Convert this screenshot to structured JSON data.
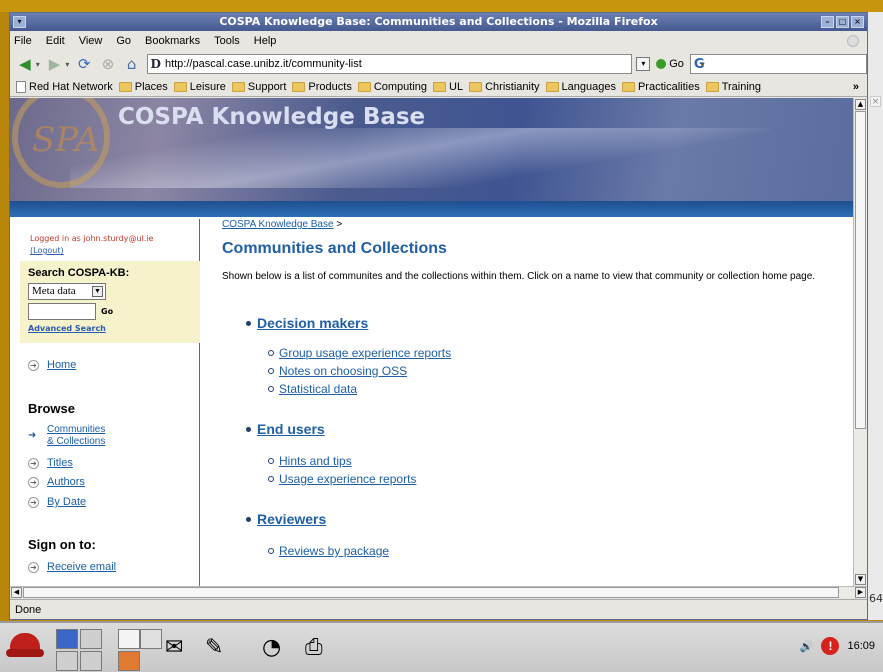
{
  "window": {
    "title": "COSPA Knowledge Base: Communities and Collections - Mozilla Firefox"
  },
  "menu": [
    "File",
    "Edit",
    "View",
    "Go",
    "Bookmarks",
    "Tools",
    "Help"
  ],
  "nav": {
    "url": "http://pascal.case.unibz.it/community-list",
    "go_label": "Go",
    "search_engine_icon": "G"
  },
  "bookmarks": [
    "Red Hat Network",
    "Places",
    "Leisure",
    "Support",
    "Products",
    "Computing",
    "UL",
    "Christianity",
    "Languages",
    "Practicalities",
    "Training"
  ],
  "bookmarks_more": "»",
  "banner": {
    "logo_letters": "SPA",
    "brand": "COSPA Knowledge Base"
  },
  "sidebar": {
    "logged_in": "Logged in as john.sturdy@ul.ie",
    "logout": "(Logout)",
    "search_heading": "Search COSPA-KB:",
    "search_scope": "Meta data",
    "go": "Go",
    "advanced": "Advanced Search",
    "home": "Home",
    "browse_heading": "Browse",
    "browse_communities_line1": "Communities",
    "browse_communities_line2": "& Collections",
    "browse_titles": "Titles",
    "browse_authors": "Authors",
    "browse_date": "By Date",
    "signon_heading": "Sign on to:",
    "receive_email": "Receive email"
  },
  "main": {
    "breadcrumb": "COSPA Knowledge Base",
    "breadcrumb_sep": ">",
    "title": "Communities and Collections",
    "intro": "Shown below is a list of communites and the collections within them. Click on a name to view that community or collection home page.",
    "communities": [
      {
        "name": "Decision makers",
        "collections": [
          "Group usage experience reports",
          "Notes on choosing OSS",
          "Statistical data"
        ]
      },
      {
        "name": "End users",
        "collections": [
          "Hints and tips",
          "Usage experience reports"
        ]
      },
      {
        "name": "Reviewers",
        "collections": [
          "Reviews by package"
        ]
      }
    ]
  },
  "status": "Done",
  "desktop_edge_num": "64",
  "clock": "16:09",
  "tray_alert": "!",
  "colors": {
    "link": "#1f5fa6",
    "title_bar": "#45598e",
    "banner_bar": "#2e6fb8",
    "search_bg": "#f6f2cc"
  }
}
